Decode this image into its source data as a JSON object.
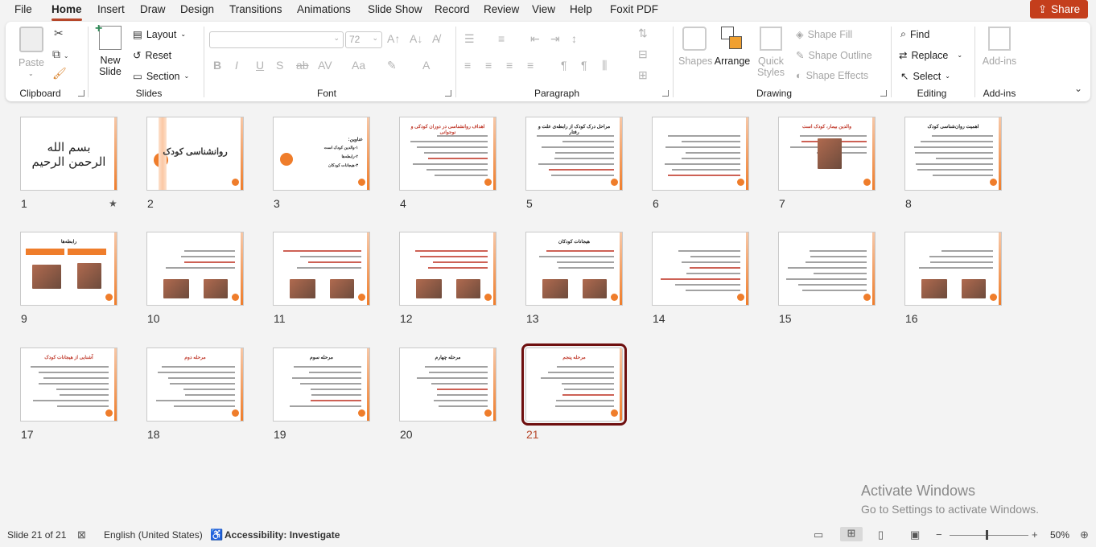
{
  "menu": {
    "tabs": [
      "File",
      "Home",
      "Insert",
      "Draw",
      "Design",
      "Transitions",
      "Animations",
      "Slide Show",
      "Record",
      "Review",
      "View",
      "Help",
      "Foxit PDF"
    ],
    "active": "Home",
    "share_label": "Share"
  },
  "ribbon": {
    "clipboard": {
      "label": "Clipboard",
      "paste": "Paste"
    },
    "slides": {
      "label": "Slides",
      "new_slide": "New Slide",
      "layout": "Layout",
      "reset": "Reset",
      "section": "Section"
    },
    "font": {
      "label": "Font",
      "font_name": "",
      "font_size": "72"
    },
    "paragraph": {
      "label": "Paragraph"
    },
    "drawing": {
      "label": "Drawing",
      "shapes": "Shapes",
      "arrange": "Arrange",
      "quick_styles": "Quick Styles",
      "shape_fill": "Shape Fill",
      "shape_outline": "Shape Outline",
      "shape_effects": "Shape Effects"
    },
    "editing": {
      "label": "Editing",
      "find": "Find",
      "replace": "Replace",
      "select": "Select"
    },
    "addins": {
      "label": "Add-ins",
      "addins": "Add-ins"
    }
  },
  "slides": [
    {
      "n": "1",
      "title": "بسم الله الرحمن الرحیم",
      "kind": "calligraphy",
      "star": "★"
    },
    {
      "n": "2",
      "title": "روانشناسی کودک",
      "kind": "title"
    },
    {
      "n": "3",
      "title": "عناوین:",
      "kind": "list",
      "items": [
        "۱-والدین کودک است",
        "۲-رابطه‌ها",
        "۳-هیجانات کودکان"
      ]
    },
    {
      "n": "4",
      "title": "اهداف روانشناسی در دوران کودکی و نوجوانی",
      "kind": "text"
    },
    {
      "n": "5",
      "title": "مراحل درک کودک از رابطه‌ی علت و رفتار",
      "kind": "text"
    },
    {
      "n": "6",
      "title": "",
      "kind": "text"
    },
    {
      "n": "7",
      "title": "والدین بیمار، کودک است",
      "kind": "textpic"
    },
    {
      "n": "8",
      "title": "اهمیت روان‌شناسی کودک",
      "kind": "text"
    },
    {
      "n": "9",
      "title": "رابطه‌ها",
      "kind": "twopics"
    },
    {
      "n": "10",
      "title": "",
      "kind": "textpics"
    },
    {
      "n": "11",
      "title": "",
      "kind": "textpics"
    },
    {
      "n": "12",
      "title": "",
      "kind": "textpics"
    },
    {
      "n": "13",
      "title": "هیجانات کودکان",
      "kind": "textpics"
    },
    {
      "n": "14",
      "title": "",
      "kind": "text"
    },
    {
      "n": "15",
      "title": "",
      "kind": "text"
    },
    {
      "n": "16",
      "title": "",
      "kind": "textpics"
    },
    {
      "n": "17",
      "title": "آشنایی از هیجانات کودک",
      "kind": "text"
    },
    {
      "n": "18",
      "title": "مرحله دوم",
      "kind": "text"
    },
    {
      "n": "19",
      "title": "مرحله سوم",
      "kind": "text"
    },
    {
      "n": "20",
      "title": "مرحله چهارم",
      "kind": "text"
    },
    {
      "n": "21",
      "title": "مرحله پنجم",
      "kind": "text",
      "selected": true
    }
  ],
  "watermark": {
    "line1": "Activate Windows",
    "line2": "Go to Settings to activate Windows."
  },
  "status": {
    "slide_count": "Slide 21 of 21",
    "language": "English (United States)",
    "accessibility": "Accessibility: Investigate",
    "zoom": "50%"
  }
}
